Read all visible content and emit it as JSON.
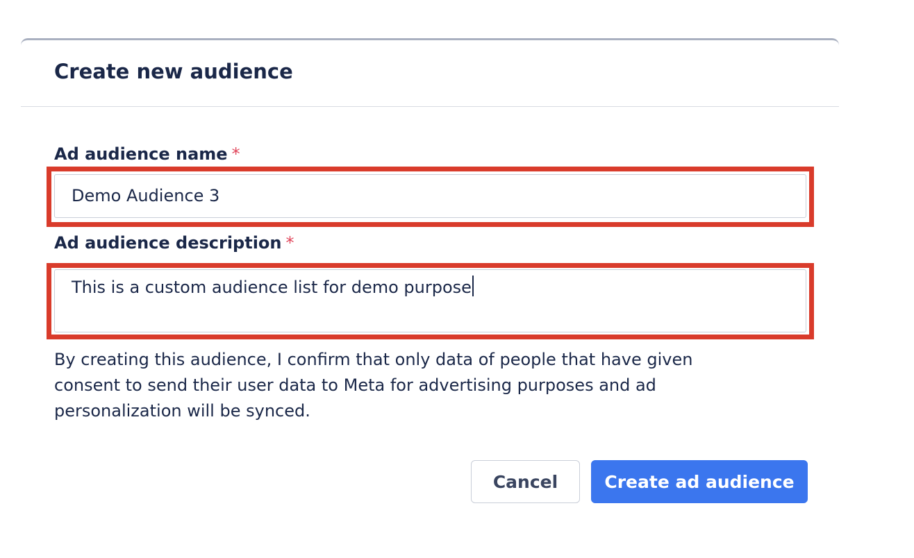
{
  "dialog": {
    "title": "Create new audience"
  },
  "form": {
    "name_label": "Ad audience name",
    "name_required": "*",
    "name_value": "Demo Audience 3",
    "description_label": "Ad audience description",
    "description_required": "*",
    "description_value": "This is a custom audience list for demo purpose",
    "consent_text": "By creating this audience, I confirm that only data of people that have given consent to send their user data to Meta for advertising purposes and ad personalization will be synced."
  },
  "actions": {
    "cancel_label": "Cancel",
    "create_label": "Create ad audience"
  },
  "colors": {
    "primary": "#3b76ee",
    "highlight": "#d93b2b",
    "required": "#e0455a",
    "text": "#1a2748"
  }
}
